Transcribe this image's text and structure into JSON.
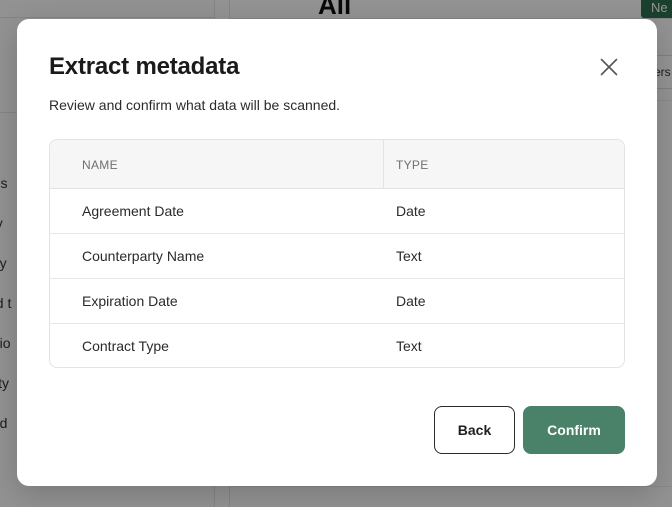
{
  "background": {
    "page_title": "All",
    "new_button_label": "Ne",
    "filter_chip_label": "ers",
    "sidebar_items": [
      "res",
      "by",
      "my",
      "ed t",
      "atio",
      "vity",
      "ted"
    ]
  },
  "modal": {
    "title": "Extract metadata",
    "subtitle": "Review and confirm what data will be scanned.",
    "close_icon": "close-icon",
    "table": {
      "headers": {
        "name": "NAME",
        "type": "TYPE"
      },
      "rows": [
        {
          "name": "Agreement Date",
          "type": "Date"
        },
        {
          "name": "Counterparty Name",
          "type": "Text"
        },
        {
          "name": "Expiration Date",
          "type": "Date"
        },
        {
          "name": "Contract Type",
          "type": "Text"
        }
      ]
    },
    "buttons": {
      "back": "Back",
      "confirm": "Confirm"
    }
  },
  "colors": {
    "confirm": "#4a8169",
    "accent_dark": "#2f6e4e",
    "overlay": "#8f8f8f"
  }
}
